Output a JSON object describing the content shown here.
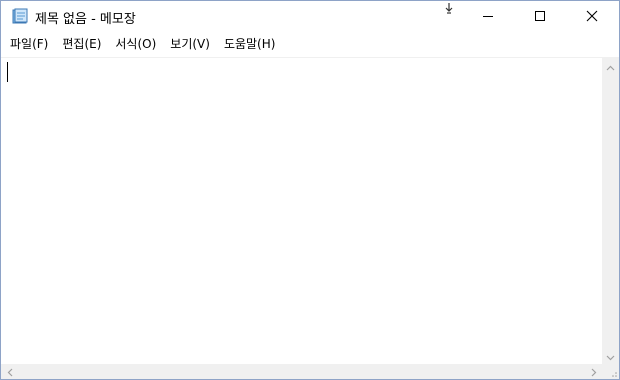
{
  "window": {
    "title": "제목 없음 - 메모장",
    "accent_border": "#8ea3c7"
  },
  "menu": {
    "items": [
      {
        "label": "파일(F)"
      },
      {
        "label": "편집(E)"
      },
      {
        "label": "서식(O)"
      },
      {
        "label": "보기(V)"
      },
      {
        "label": "도움말(H)"
      }
    ]
  },
  "editor": {
    "text": ""
  },
  "icons": {
    "app": "notepad-icon",
    "minimize": "minimize-icon",
    "maximize": "maximize-icon",
    "close": "close-icon",
    "scroll_up": "chevron-up-icon",
    "scroll_down": "chevron-down-icon",
    "scroll_left": "chevron-left-icon",
    "scroll_right": "chevron-right-icon"
  }
}
